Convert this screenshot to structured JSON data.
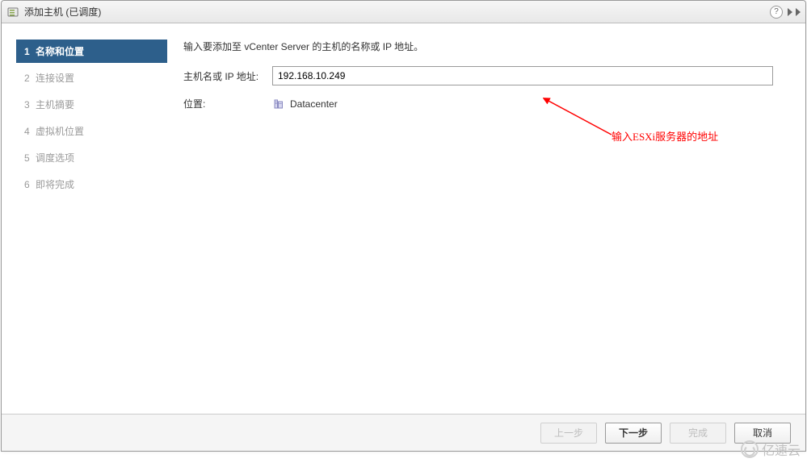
{
  "titlebar": {
    "title": "添加主机 (已调度)"
  },
  "sidebar": {
    "steps": [
      {
        "num": "1",
        "label": "名称和位置"
      },
      {
        "num": "2",
        "label": "连接设置"
      },
      {
        "num": "3",
        "label": "主机摘要"
      },
      {
        "num": "4",
        "label": "虚拟机位置"
      },
      {
        "num": "5",
        "label": "调度选项"
      },
      {
        "num": "6",
        "label": "即将完成"
      }
    ]
  },
  "content": {
    "instruction": "输入要添加至 vCenter Server 的主机的名称或 IP 地址。",
    "hostname_label": "主机名或 IP 地址:",
    "hostname_value": "192.168.10.249",
    "location_label": "位置:",
    "location_value": "Datacenter"
  },
  "annotation": {
    "text": "输入ESXi服务器的地址"
  },
  "footer": {
    "back": "上一步",
    "next": "下一步",
    "finish": "完成",
    "cancel": "取消"
  },
  "watermark": {
    "text": "亿速云"
  }
}
